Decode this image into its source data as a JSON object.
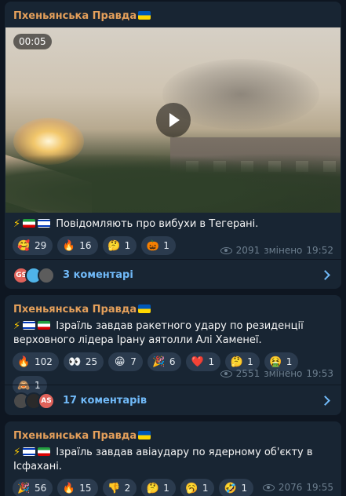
{
  "channel_name": "Пхеньянська Правда",
  "posts": [
    {
      "video_duration": "00:05",
      "text": "Повідомляють про вибухи в Тегерані.",
      "reactions": [
        {
          "emoji": "🥰",
          "count": "29"
        },
        {
          "emoji": "🔥",
          "count": "16"
        },
        {
          "emoji": "🤔",
          "count": "1"
        },
        {
          "emoji": "🎃",
          "count": "1"
        }
      ],
      "views": "2091",
      "edited_label": "змінено",
      "time": "19:52",
      "avatars": [
        "GS",
        "",
        ""
      ],
      "comments_label": "3 коментарі"
    },
    {
      "text": "Ізраїль завдав ракетного удару по резиденції верховного лідера Ірану аятолли Алі Хаменеї.",
      "reactions": [
        {
          "emoji": "🔥",
          "count": "102"
        },
        {
          "emoji": "👀",
          "count": "25"
        },
        {
          "emoji": "😁",
          "count": "7"
        },
        {
          "emoji": "🎉",
          "count": "6"
        },
        {
          "emoji": "❤️",
          "count": "1"
        },
        {
          "emoji": "🤔",
          "count": "1"
        },
        {
          "emoji": "🤮",
          "count": "1"
        },
        {
          "emoji": "🙈",
          "count": "1"
        }
      ],
      "views": "2551",
      "edited_label": "змінено",
      "time": "19:53",
      "avatars": [
        "",
        "",
        "AS"
      ],
      "comments_label": "17 коментарів"
    },
    {
      "text": "Ізраїль завдав авіаудару по ядерному об'єкту в Ісфахані.",
      "reactions": [
        {
          "emoji": "🎉",
          "count": "56"
        },
        {
          "emoji": "🔥",
          "count": "15"
        },
        {
          "emoji": "👎",
          "count": "2"
        },
        {
          "emoji": "🤔",
          "count": "1"
        },
        {
          "emoji": "🥱",
          "count": "1"
        },
        {
          "emoji": "🤣",
          "count": "1"
        }
      ],
      "views": "2076",
      "time": "19:55"
    }
  ]
}
